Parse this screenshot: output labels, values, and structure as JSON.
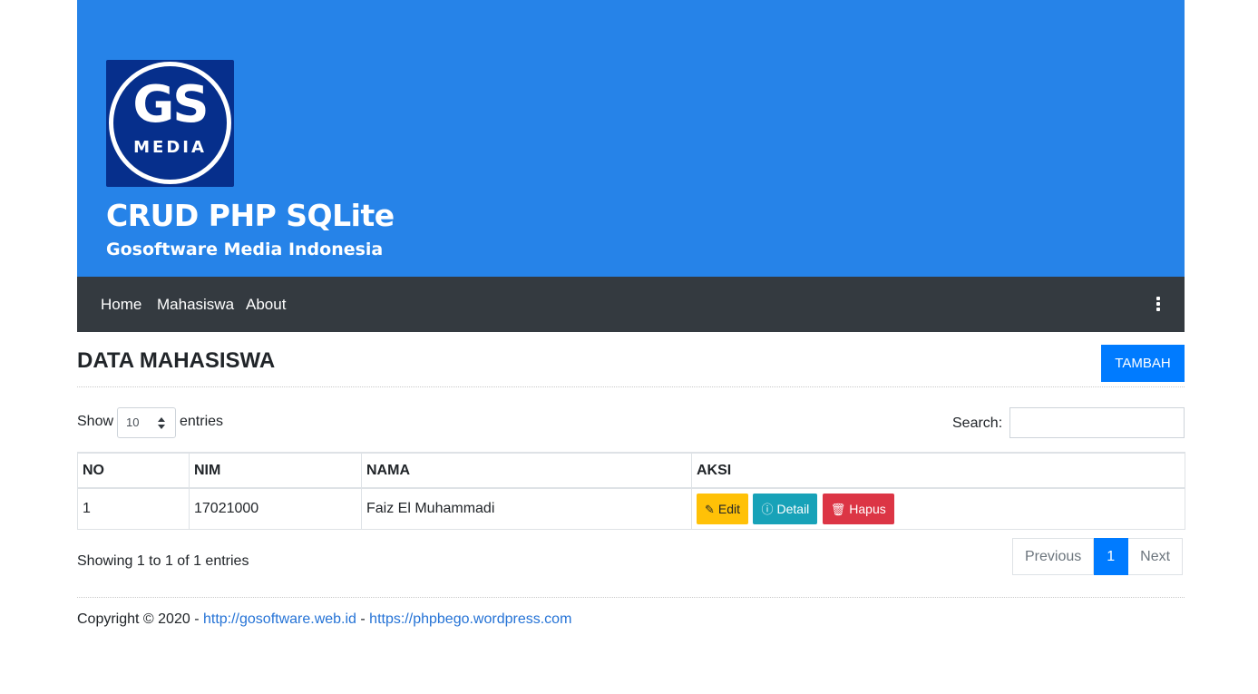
{
  "brand": {
    "logo_text": "GS",
    "logo_subtext": "MEDIA",
    "title": "CRUD PHP SQLite",
    "subtitle": "Gosoftware Media Indonesia",
    "colors": {
      "banner": "#2683e8",
      "logo_bg": "#062f8c"
    }
  },
  "nav": {
    "items": [
      {
        "label": "Home"
      },
      {
        "label": "Mahasiswa"
      },
      {
        "label": "About"
      }
    ],
    "menu_icon": "kebab-vertical-icon"
  },
  "page": {
    "title": "DATA MAHASISWA",
    "add_button": "TAMBAH"
  },
  "controls": {
    "show_label": "Show",
    "entries_value": "10",
    "entries_label": "entries",
    "search_label": "Search:",
    "search_value": ""
  },
  "table": {
    "headers": [
      "NO",
      "NIM",
      "NAMA",
      "AKSI"
    ],
    "rows": [
      {
        "no": "1",
        "nim": "17021000",
        "nama": "Faiz El Muhammadi",
        "actions": {
          "edit": "Edit",
          "detail": "Detail",
          "hapus": "Hapus"
        }
      }
    ]
  },
  "info": "Showing 1 to 1 of 1 entries",
  "pagination": {
    "previous": "Previous",
    "current": "1",
    "next": "Next"
  },
  "footer": {
    "prefix": "Copyright © 2020 - ",
    "link1": "http://gosoftware.web.id",
    "separator": " - ",
    "link2": "https://phpbego.wordpress.com"
  }
}
